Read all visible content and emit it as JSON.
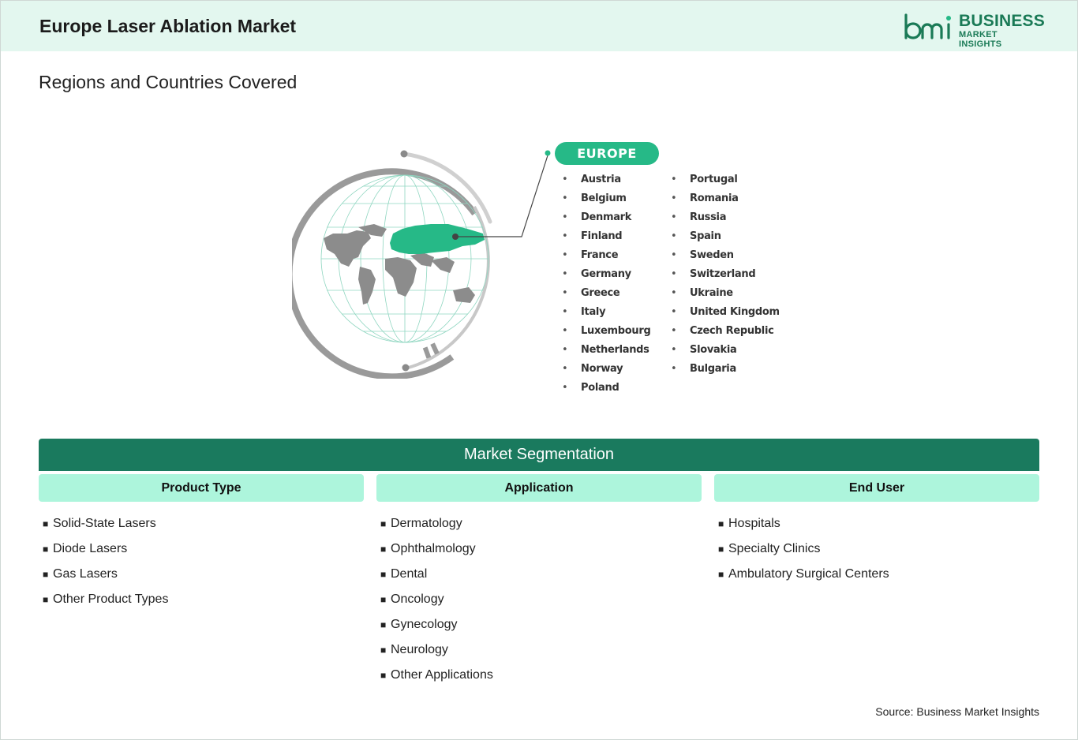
{
  "header": {
    "title": "Europe Laser Ablation Market",
    "logo_mark": "bmi",
    "logo_line1": "BUSINESS",
    "logo_line2": "MARKET INSIGHTS"
  },
  "regions": {
    "title": "Regions and Countries Covered",
    "region_label": "EUROPE",
    "highlight_color": "#26b987",
    "countries_col1": [
      "Austria",
      "Belgium",
      "Denmark",
      "Finland",
      "France",
      "Germany",
      "Greece",
      "Italy",
      "Luxembourg",
      "Netherlands",
      "Norway",
      "Poland"
    ],
    "countries_col2": [
      "Portugal",
      "Romania",
      "Russia",
      "Spain",
      "Sweden",
      "Switzerland",
      "Ukraine",
      "United Kingdom",
      "Czech Republic",
      "Slovakia",
      "Bulgaria"
    ]
  },
  "segmentation": {
    "title": "Market Segmentation",
    "bar_color": "#1a7a5e",
    "header_color": "#adf5dc",
    "columns": [
      {
        "heading": "Product Type",
        "items": [
          "Solid-State Lasers",
          "Diode Lasers",
          "Gas Lasers",
          "Other Product Types"
        ]
      },
      {
        "heading": "Application",
        "items": [
          "Dermatology",
          "Ophthalmology",
          "Dental",
          "Oncology",
          "Gynecology",
          "Neurology",
          "Other Applications"
        ]
      },
      {
        "heading": "End User",
        "items": [
          "Hospitals",
          "Specialty Clinics",
          "Ambulatory Surgical Centers"
        ]
      }
    ]
  },
  "footer": {
    "source": "Source: Business Market Insights"
  }
}
